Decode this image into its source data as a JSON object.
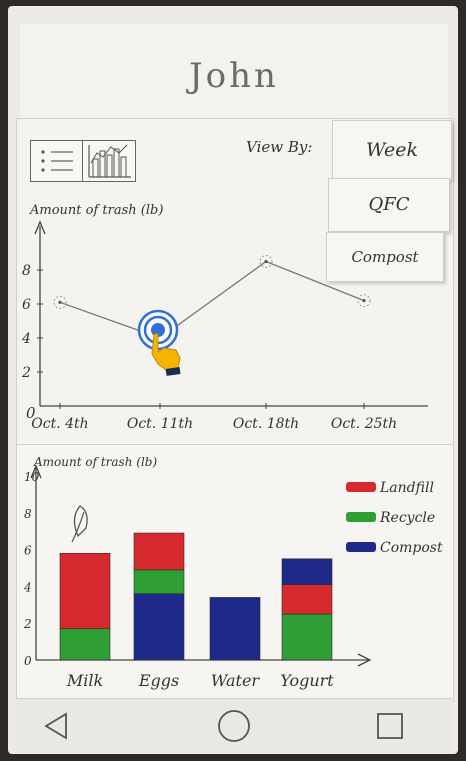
{
  "header": {
    "title": "John"
  },
  "controls": {
    "view_by_label": "View By:",
    "time_option": "Week",
    "store_option": "QFC",
    "type_option": "Compost"
  },
  "icons": {
    "list_view": "list-icon",
    "chart_view": "bar-chart-icon",
    "pointer": "hand-pointer-icon",
    "leaf": "leaf-icon"
  },
  "colors": {
    "landfill": "#d62a2e",
    "recycle": "#2f9e35",
    "compost": "#1d2a8a"
  },
  "nav": {
    "back": "back-triangle-icon",
    "home": "home-circle-icon",
    "recents": "recents-square-icon"
  },
  "chart_data": [
    {
      "type": "line",
      "ylabel": "Amount of trash (lb)",
      "categories": [
        "Oct. 4th",
        "Oct. 11th",
        "Oct. 18th",
        "Oct. 25th"
      ],
      "series": [
        {
          "values": [
            6.1,
            4.0,
            8.5,
            6.2
          ]
        }
      ],
      "yticks": [
        2,
        4,
        6,
        8
      ],
      "ylim": [
        0,
        10
      ],
      "x_origin_label": "0"
    },
    {
      "type": "bar",
      "stacked": true,
      "ylabel": "Amount of trash (lb)",
      "categories": [
        "Milk",
        "Eggs",
        "Water",
        "Yogurt"
      ],
      "series": [
        {
          "name": "Compost",
          "values": [
            0,
            3.6,
            3.4,
            0
          ]
        },
        {
          "name": "Recycle",
          "values": [
            1.7,
            1.3,
            0,
            2.5
          ]
        },
        {
          "name": "Landfill",
          "values": [
            4.1,
            2.0,
            0,
            1.6
          ]
        },
        {
          "name": "Compost",
          "values": [
            0,
            0,
            0,
            1.4
          ]
        }
      ],
      "legend": [
        "Landfill",
        "Recycle",
        "Compost"
      ],
      "yticks": [
        0,
        2,
        4,
        6,
        8,
        10
      ],
      "ylim": [
        0,
        10
      ],
      "legend_position": "top-right"
    }
  ]
}
